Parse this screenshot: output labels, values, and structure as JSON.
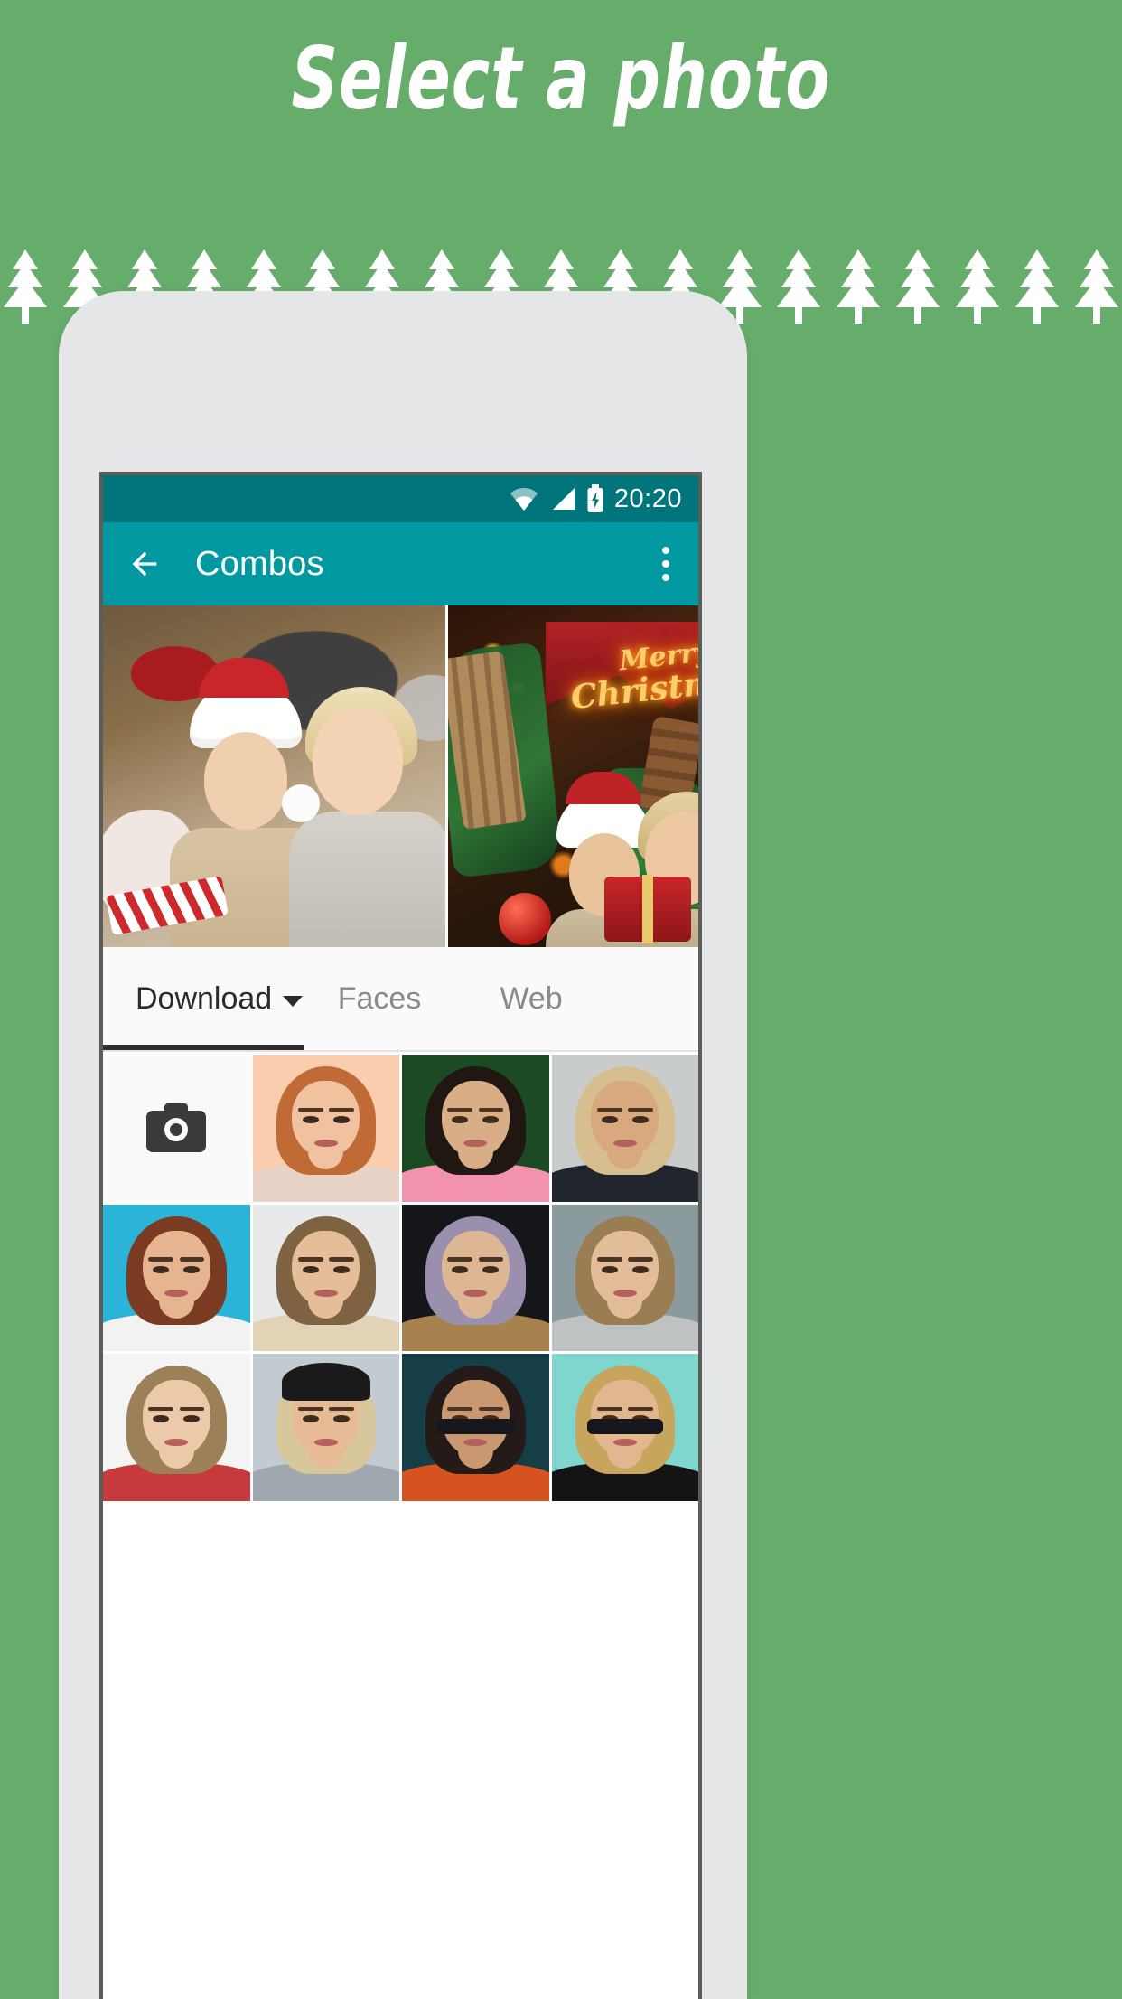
{
  "promo": {
    "title": "Select a photo",
    "background_color": "#66AC6A",
    "decoration": {
      "icon": "pine-tree-icon",
      "count": 19,
      "color": "#FFFFFF"
    }
  },
  "phone": {
    "body_color": "#E4E6E7",
    "bezel_color": "#5C5C58"
  },
  "statusbar": {
    "background_color": "#00767C",
    "time": "20:20",
    "icons": [
      "wifi-icon",
      "cellular-signal-icon",
      "battery-charging-icon"
    ]
  },
  "appbar": {
    "background_color": "#0099A2",
    "back_icon": "back-arrow-icon",
    "title": "Combos",
    "overflow_icon": "overflow-menu-icon"
  },
  "preview": {
    "before_label": "original-photo",
    "after_label": "christmas-combo-photo",
    "after_overlay_text_line1": "Merry",
    "after_overlay_text_line2": "Christmas"
  },
  "tabs": {
    "active_index": 0,
    "items": [
      {
        "label": "Download",
        "has_caret": true
      },
      {
        "label": "Faces",
        "has_caret": false
      },
      {
        "label": "Web",
        "has_caret": false
      }
    ]
  },
  "grid": {
    "columns": 4,
    "cells": [
      {
        "type": "camera",
        "icon": "camera-icon",
        "name": "open-camera-tile"
      },
      {
        "type": "photo",
        "name": "photo-tile-1",
        "bg": "#F9CDAE",
        "hair": "#C06A35",
        "face": "#F0C2A0",
        "cloth": "#E8D3C6",
        "hat": null,
        "glasses": false
      },
      {
        "type": "photo",
        "name": "photo-tile-2",
        "bg": "#1B4A23",
        "hair": "#211712",
        "face": "#D9AE86",
        "cloth": "#F392AE",
        "hat": null,
        "glasses": false
      },
      {
        "type": "photo",
        "name": "photo-tile-3",
        "bg": "#C8CDCB",
        "hair": "#D7BE8F",
        "face": "#D8A87F",
        "cloth": "#20242C",
        "hat": null,
        "glasses": false
      },
      {
        "type": "photo",
        "name": "photo-tile-4",
        "bg": "#2BB4D8",
        "hair": "#7A3B22",
        "face": "#E7B491",
        "cloth": "#F2F2F2",
        "hat": null,
        "glasses": false
      },
      {
        "type": "photo",
        "name": "photo-tile-5",
        "bg": "#E8EAEA",
        "hair": "#7E6242",
        "face": "#E6BD99",
        "cloth": "#E2D3B6",
        "hat": null,
        "glasses": false
      },
      {
        "type": "photo",
        "name": "photo-tile-6",
        "bg": "#14161A",
        "hair": "#9B8FAE",
        "face": "#DDB694",
        "cloth": "#A8824E",
        "hat": null,
        "glasses": false
      },
      {
        "type": "photo",
        "name": "photo-tile-7",
        "bg": "#8B9A9D",
        "hair": "#9A7D52",
        "face": "#E3BD9A",
        "cloth": "#BFC2C2",
        "hat": null,
        "glasses": false
      },
      {
        "type": "photo",
        "name": "photo-tile-8",
        "bg": "#F4F4F4",
        "hair": "#9B8058",
        "face": "#EBC9A9",
        "cloth": "#C6393C",
        "hat": null,
        "glasses": false
      },
      {
        "type": "photo",
        "name": "photo-tile-9",
        "bg": "#C2CBD2",
        "hair": "#D8C79C",
        "face": "#E6BB95",
        "cloth": "#9FA8AE",
        "hat": "#1A1A1C",
        "glasses": false
      },
      {
        "type": "photo",
        "name": "photo-tile-10",
        "bg": "#163E46",
        "hair": "#241A18",
        "face": "#C99870",
        "cloth": "#D6521F",
        "hat": null,
        "glasses": true
      },
      {
        "type": "photo",
        "name": "photo-tile-11",
        "bg": "#7FD6CE",
        "hair": "#C8A55C",
        "face": "#E2B68E",
        "cloth": "#141414",
        "hat": null,
        "glasses": true
      }
    ]
  }
}
